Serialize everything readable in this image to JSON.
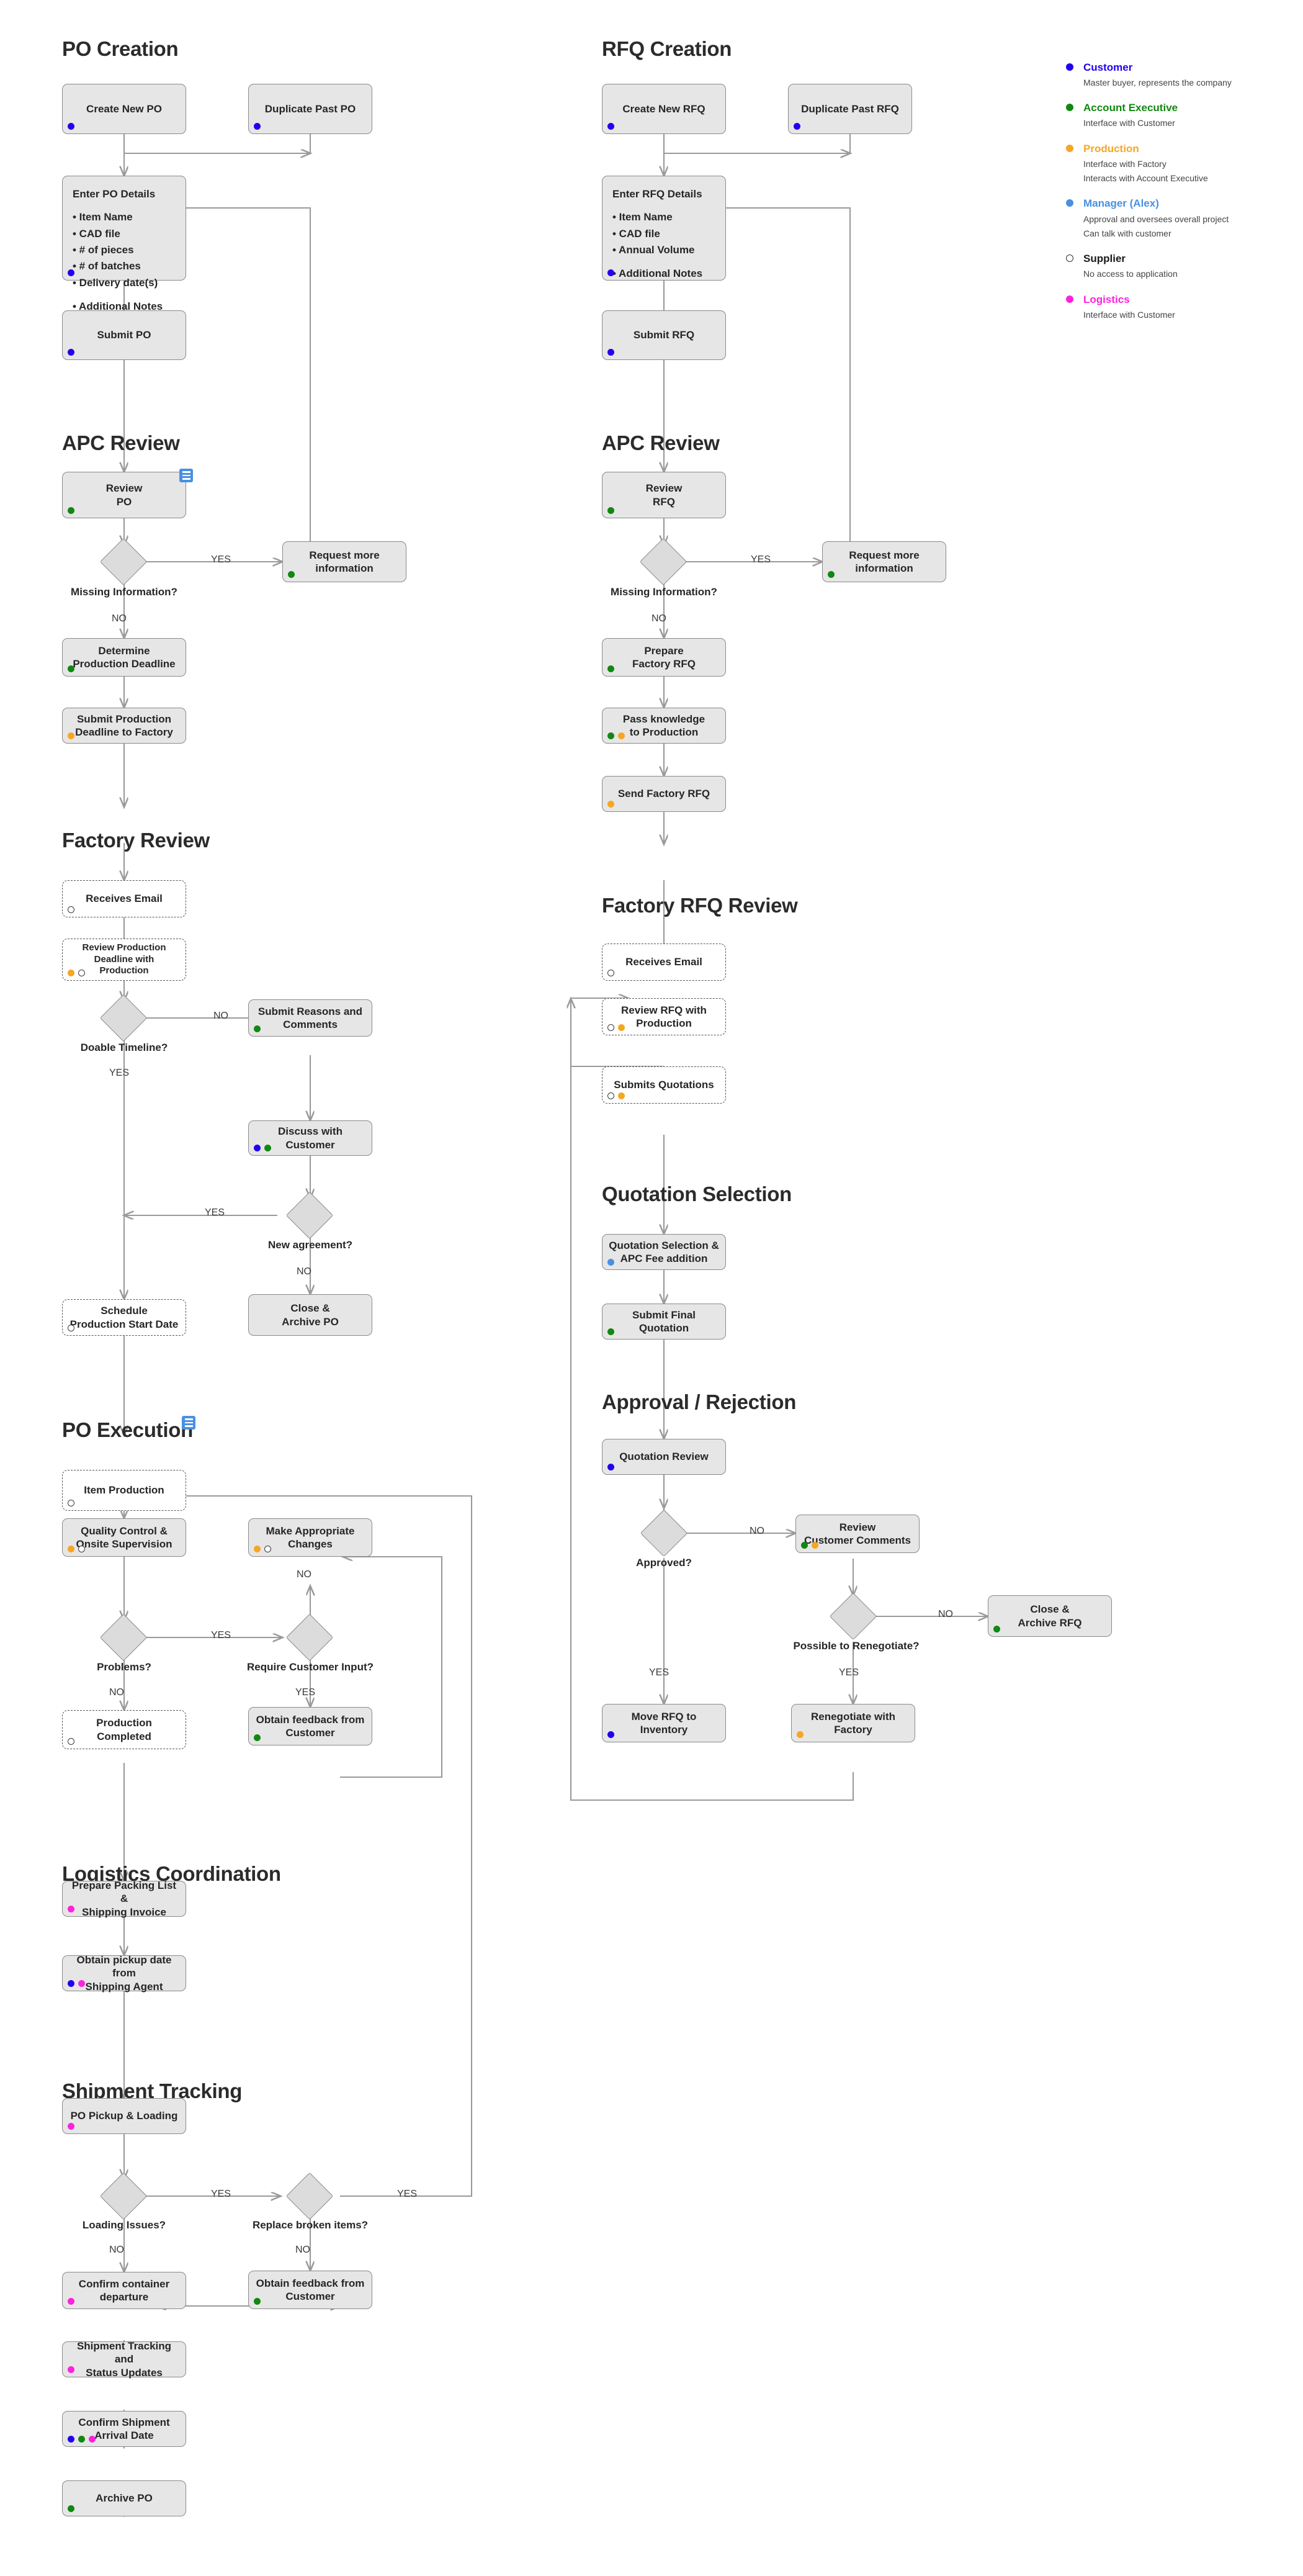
{
  "legend": {
    "items": [
      {
        "role": "Customer",
        "color": "#2200ee",
        "hollow": false,
        "desc": [
          "Master buyer, represents the company"
        ]
      },
      {
        "role": "Account Executive",
        "color": "#118811",
        "hollow": false,
        "desc": [
          "Interface with Customer"
        ]
      },
      {
        "role": "Production",
        "color": "#f5a623",
        "hollow": false,
        "desc": [
          "Interface with Factory",
          "Interacts with Account Executive"
        ]
      },
      {
        "role": "Manager (Alex)",
        "color": "#4a90e2",
        "hollow": false,
        "desc": [
          "Approval and oversees overall project",
          "Can talk with customer"
        ]
      },
      {
        "role": "Supplier",
        "color": "#ffffff",
        "hollow": true,
        "desc": [
          "No access to application"
        ]
      },
      {
        "role": "Logistics",
        "color": "#ff22dd",
        "hollow": false,
        "desc": [
          "Interface with Customer"
        ]
      }
    ]
  },
  "headings": {
    "po_creation": "PO Creation",
    "apc_review_left": "APC Review",
    "factory_review": "Factory Review",
    "po_execution": "PO Execution",
    "logistics_coordination": "Logistics Coordination",
    "shipment_tracking": "Shipment Tracking",
    "rfq_creation": "RFQ Creation",
    "apc_review_right": "APC Review",
    "factory_rfq_review": "Factory RFQ Review",
    "quotation_selection": "Quotation Selection",
    "approval_rejection": "Approval / Rejection"
  },
  "nodes": {
    "create_new_po": "Create New PO",
    "duplicate_past_po": "Duplicate Past PO",
    "enter_po_title": "Enter PO Details",
    "submit_po": "Submit PO",
    "review_po": "Review\nPO",
    "request_more_info_po": "Request more\ninformation",
    "determine_production_deadline": "Determine\nProduction Deadline",
    "submit_deadline_factory": "Submit Production\nDeadline to Factory",
    "receives_email_po": "Receives Email",
    "review_deadline_production": "Review Production\nDeadline with\nProduction",
    "submit_reasons_comments": "Submit Reasons and\nComments",
    "discuss_with_customer": "Discuss with\nCustomer",
    "schedule_production_start": "Schedule\nProduction Start Date",
    "close_archive_po": "Close &\nArchive PO",
    "item_production": "Item Production",
    "quality_control": "Quality Control &\nOnsite Supervision",
    "make_appropriate_changes": "Make Appropriate\nChanges",
    "production_completed": "Production Completed",
    "obtain_feedback_customer_1": "Obtain feedback from\nCustomer",
    "prepare_packing_list": "Prepare Packing List &\nShipping Invoice",
    "obtain_pickup_date": "Obtain pickup date from\nShipping Agent",
    "po_pickup_loading": "PO Pickup & Loading",
    "confirm_container_departure": "Confirm container\ndeparture",
    "obtain_feedback_customer_2": "Obtain feedback from\nCustomer",
    "shipment_tracking_status": "Shipment Tracking and\nStatus Updates",
    "confirm_shipment_arrival": "Confirm Shipment\nArrival Date",
    "archive_po": "Archive PO",
    "create_new_rfq": "Create New RFQ",
    "duplicate_past_rfq": "Duplicate Past RFQ",
    "enter_rfq_title": "Enter RFQ Details",
    "submit_rfq": "Submit RFQ",
    "review_rfq": "Review\nRFQ",
    "request_more_info_rfq": "Request more\ninformation",
    "prepare_factory_rfq": "Prepare\nFactory RFQ",
    "pass_knowledge_production": "Pass knowledge\nto Production",
    "send_factory_rfq": "Send Factory RFQ",
    "receives_email_rfq": "Receives Email",
    "review_rfq_production": "Review RFQ with\nProduction",
    "submits_quotations": "Submits Quotations",
    "quotation_selection_fee": "Quotation Selection &\nAPC Fee addition",
    "submit_final_quotation": "Submit Final Quotation",
    "quotation_review": "Quotation Review",
    "review_customer_comments": "Review\nCustomer Comments",
    "close_archive_rfq": "Close &\nArchive RFQ",
    "move_rfq_inventory": "Move RFQ to\nInventory",
    "renegotiate_factory": "Renegotiate with\nFactory"
  },
  "po_detail_items": [
    "• Item Name",
    "• CAD file",
    "• # of pieces",
    "• # of batches",
    "• Delivery date(s)",
    "",
    "• Additional Notes"
  ],
  "rfq_detail_items": [
    "• Item Name",
    "• CAD file",
    "• Annual Volume",
    "",
    "• Additional Notes"
  ],
  "decisions": {
    "missing_info_po": "Missing Information?",
    "doable_timeline": "Doable Timeline?",
    "new_agreement": "New agreement?",
    "problems": "Problems?",
    "require_customer_input": "Require Customer Input?",
    "loading_issues": "Loading Issues?",
    "replace_broken_items": "Replace broken items?",
    "missing_info_rfq": "Missing Information?",
    "approved": "Approved?",
    "possible_renegotiate": "Possible to Renegotiate?"
  },
  "edge_labels": {
    "yes": "YES",
    "no": "NO"
  }
}
